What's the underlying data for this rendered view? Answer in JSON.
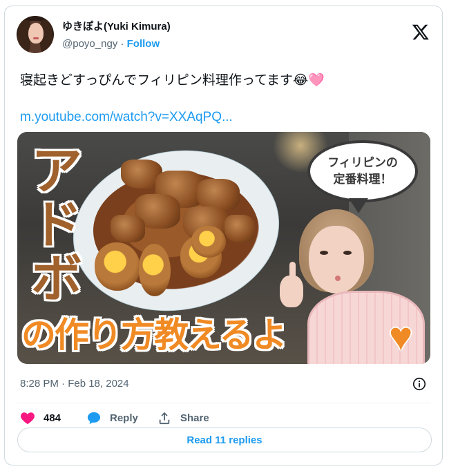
{
  "header": {
    "display_name": "ゆきぽよ(Yuki Kimura)",
    "handle": "@poyo_ngy",
    "separator": "·",
    "follow_label": "Follow"
  },
  "tweet": {
    "text": "寝起きどすっぴんでフィリピン料理作ってます",
    "emojis": "😂🩷",
    "link_text": "m.youtube.com/watch?v=XXAqPQ..."
  },
  "media": {
    "title_vertical": [
      "ア",
      "ド",
      "ボ"
    ],
    "subtitle": "の作り方教えるよ",
    "heart": "♥",
    "bubble_line1": "フィリピンの",
    "bubble_line2": "定番料理！"
  },
  "meta": {
    "timestamp": "8:28 PM · Feb 18, 2024"
  },
  "actions": {
    "like_count": "484",
    "reply_label": "Reply",
    "share_label": "Share"
  },
  "footer": {
    "read_replies_label": "Read 11 replies"
  },
  "colors": {
    "accent": "#1d9bf0",
    "like": "#f91880",
    "text_primary": "#0f1419",
    "text_secondary": "#536471",
    "media_title": "#a0612c",
    "media_subtitle": "#f08a24"
  },
  "icons": {
    "logo": "x-logo-icon",
    "info": "info-icon",
    "like": "heart-icon",
    "reply": "reply-bubble-icon",
    "share": "share-upload-icon"
  }
}
